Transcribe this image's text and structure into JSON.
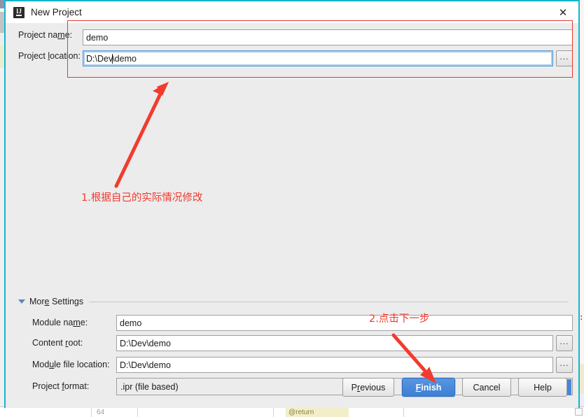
{
  "window": {
    "title": "New Project",
    "app_icon": "intellij-idea-icon",
    "close_icon": "close-icon",
    "border_color": "#16b5c9"
  },
  "form": {
    "project_name": {
      "label": "Project name:",
      "label_pre": "Project na",
      "label_mnemonic": "m",
      "label_post": "e:",
      "value": "demo",
      "focused": false
    },
    "project_location": {
      "label": "Project location:",
      "label_pre": "Project ",
      "label_mnemonic": "l",
      "label_post": "ocation:",
      "value_pre": "D:\\Dev",
      "value_post": "\\demo",
      "value": "D:\\Dev\\demo",
      "focused": true,
      "browse_label": "..."
    }
  },
  "more_settings": {
    "label": "More Settings",
    "label_pre": "Mor",
    "label_mnemonic": "e",
    "label_post": " Settings",
    "expanded": true,
    "expander_icon": "triangle-down-icon",
    "fields": [
      {
        "name": "module-name",
        "label": "Module name:",
        "label_pre": "Module na",
        "label_mnemonic": "m",
        "label_post": "e:",
        "value": "demo",
        "has_browse": false
      },
      {
        "name": "content-root",
        "label": "Content root:",
        "label_pre": "Content ",
        "label_mnemonic": "r",
        "label_post": "oot:",
        "value": "D:\\Dev\\demo",
        "has_browse": true,
        "browse_label": "..."
      },
      {
        "name": "module-file-location",
        "label": "Module file location:",
        "label_pre": "Mod",
        "label_mnemonic": "u",
        "label_post": "le file location:",
        "value": "D:\\Dev\\demo",
        "has_browse": true,
        "browse_label": "..."
      }
    ],
    "project_format": {
      "label": "Project format:",
      "label_pre": "Project ",
      "label_mnemonic": "f",
      "label_post": "ormat:",
      "value": ".ipr (file based)",
      "dropdown_icon": "chevron-down-icon",
      "dropdown_color": "#4a86d8"
    }
  },
  "footer": {
    "buttons": [
      {
        "name": "previous-button",
        "label": "Previous",
        "pre": "P",
        "mn": "r",
        "post": "evious",
        "primary": false
      },
      {
        "name": "finish-button",
        "label": "Finish",
        "pre": "",
        "mn": "F",
        "post": "inish",
        "primary": true
      },
      {
        "name": "cancel-button",
        "label": "Cancel",
        "pre": "",
        "mn": "",
        "post": "Cancel",
        "primary": false
      },
      {
        "name": "help-button",
        "label": "Help",
        "pre": "",
        "mn": "",
        "post": "Help",
        "primary": false
      }
    ]
  },
  "annotations": {
    "color": "#f0392e",
    "step1": "1.根据自己的实际情况修改",
    "step2": "2.点击下一步",
    "highlight_box": "red-rectangle-around-project-fields"
  },
  "background": {
    "right_edge_text": "t:",
    "bottom_status_number": "64",
    "bottom_highlight_text": "@return"
  }
}
